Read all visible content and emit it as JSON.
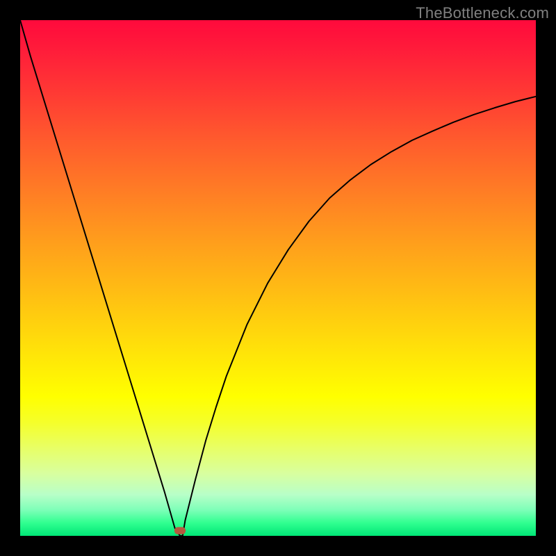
{
  "attribution": "TheBottleneck.com",
  "chart_data": {
    "type": "line",
    "title": "",
    "xlabel": "",
    "ylabel": "",
    "xlim": [
      0,
      100
    ],
    "ylim": [
      0,
      100
    ],
    "axes_visible": false,
    "grid": false,
    "background_gradient": {
      "direction": "vertical",
      "stops": [
        {
          "pos": 0.0,
          "color": "#ff0a3c"
        },
        {
          "pos": 0.5,
          "color": "#ffbe13"
        },
        {
          "pos": 0.73,
          "color": "#ffff00"
        },
        {
          "pos": 1.0,
          "color": "#00e676"
        }
      ]
    },
    "series": [
      {
        "name": "curve",
        "color": "#000000",
        "width": 2,
        "x": [
          0,
          2,
          4,
          6,
          8,
          10,
          12,
          14,
          16,
          18,
          20,
          22,
          24,
          26,
          28,
          29,
          30,
          31,
          31.5,
          32,
          34,
          36,
          38,
          40,
          44,
          48,
          52,
          56,
          60,
          64,
          68,
          72,
          76,
          80,
          84,
          88,
          92,
          96,
          100
        ],
        "y": [
          100,
          93,
          86.5,
          80,
          73.5,
          67,
          60.5,
          54,
          47.5,
          41,
          34.5,
          28,
          21.5,
          15,
          8.5,
          5,
          1.5,
          0,
          0,
          3,
          11,
          18.5,
          25,
          31,
          41,
          49,
          55.5,
          61,
          65.5,
          69,
          72,
          74.5,
          76.7,
          78.5,
          80.2,
          81.7,
          83,
          84.2,
          85.2
        ]
      }
    ],
    "marker": {
      "name": "bottleneck-point",
      "x": 31,
      "y": 1,
      "shape": "rounded-rect",
      "color": "#b5593f",
      "width_pct": 2.2,
      "height_pct": 1.4
    }
  }
}
